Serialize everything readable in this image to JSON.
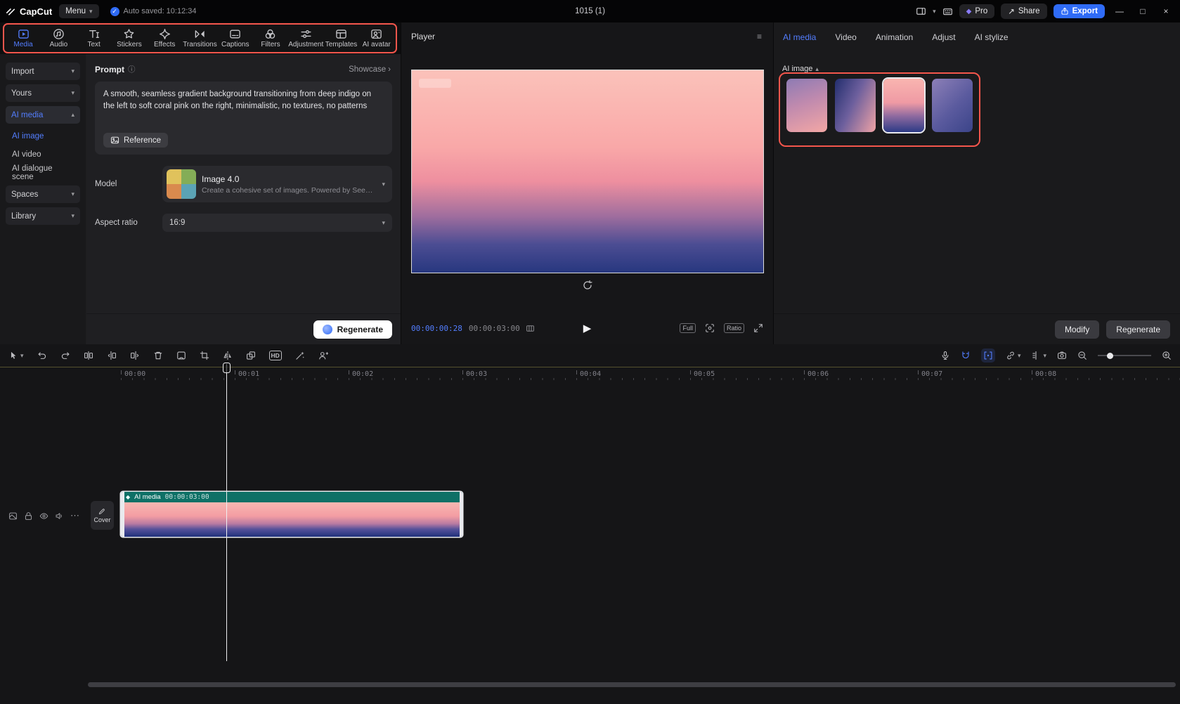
{
  "icons": {
    "chevron_down": "▾",
    "chevron_up": "▴",
    "chevron_right": "›",
    "play": "▶",
    "ellipsis": "⋯",
    "hamburger": "≡",
    "close": "×",
    "minimize": "—",
    "maximize": "□",
    "share_arrow": "↗",
    "gem": "◆",
    "check": "✓",
    "info": "ⓘ",
    "clip_sparkle": "◆"
  },
  "topbar": {
    "logo_text": "CapCut",
    "menu_label": "Menu",
    "autosave_text": "Auto saved: 10:12:34",
    "project_title": "1015 (1)",
    "pro_label": "Pro",
    "share_label": "Share",
    "export_label": "Export"
  },
  "toolbar": {
    "items": [
      {
        "label": "Media",
        "active": true
      },
      {
        "label": "Audio"
      },
      {
        "label": "Text"
      },
      {
        "label": "Stickers"
      },
      {
        "label": "Effects"
      },
      {
        "label": "Transitions"
      },
      {
        "label": "Captions"
      },
      {
        "label": "Filters"
      },
      {
        "label": "Adjustment"
      },
      {
        "label": "Templates"
      },
      {
        "label": "AI avatar"
      }
    ]
  },
  "sidebar": {
    "import_label": "Import",
    "yours_label": "Yours",
    "ai_media_label": "AI media",
    "ai_image_label": "AI image",
    "ai_video_label": "AI video",
    "ai_dialogue_label": "AI dialogue scene",
    "spaces_label": "Spaces",
    "library_label": "Library"
  },
  "prompt_panel": {
    "title": "Prompt",
    "showcase_label": "Showcase",
    "prompt_text": "A smooth, seamless gradient background transitioning from deep indigo on the left to soft coral pink on the right, minimalistic, no textures, no patterns",
    "reference_label": "Reference",
    "model_label": "Model",
    "model_name": "Image 4.0",
    "model_desc": "Create a cohesive set of images. Powered by Seedr...",
    "aspect_label": "Aspect ratio",
    "aspect_value": "16:9",
    "regenerate_label": "Regenerate"
  },
  "player": {
    "title": "Player",
    "current_time": "00:00:00:28",
    "duration": "00:00:03:00",
    "full_label": "Full",
    "ratio_label": "Ratio",
    "preview_gradient": {
      "angle": "180deg",
      "stops": [
        "#fbc2ba 0%",
        "#f9a8a8 38%",
        "#ee8f9f 55%",
        "#a06e9e 72%",
        "#4c4d93 86%",
        "#27377f 100%"
      ]
    }
  },
  "right_panel": {
    "tabs": [
      {
        "label": "AI media",
        "active": true
      },
      {
        "label": "Video"
      },
      {
        "label": "Animation"
      },
      {
        "label": "Adjust"
      },
      {
        "label": "AI stylize"
      }
    ],
    "section_label": "AI image",
    "thumbnails": [
      {
        "angle": "160deg",
        "stops": [
          "#8d7bb4 0%",
          "#c08aae 45%",
          "#f3a7a5 100%"
        ]
      },
      {
        "angle": "115deg",
        "stops": [
          "#222e6e 0%",
          "#6d5f9d 45%",
          "#f0a3a6 100%"
        ]
      },
      {
        "angle": "180deg",
        "stops": [
          "#f9b5b0 0%",
          "#ef9aa4 45%",
          "#8f6aa0 70%",
          "#2c3b86 100%"
        ]
      },
      {
        "angle": "135deg",
        "stops": [
          "#8d80b8 0%",
          "#5a5a9e 55%",
          "#3b4489 100%"
        ]
      }
    ],
    "modify_label": "Modify",
    "regenerate_label": "Regenerate"
  },
  "timeline": {
    "ruler_labels": [
      "00:00",
      "00:01",
      "00:02",
      "00:03",
      "00:04",
      "00:05",
      "00:06",
      "00:07",
      "00:08"
    ],
    "hd_label": "HD",
    "cover_label": "Cover",
    "clip": {
      "label": "AI media",
      "duration": "00:00:03:00",
      "gradient": {
        "angle": "180deg",
        "stops": [
          "#f8b7b1 0%",
          "#f39da3 40%",
          "#b97ba2 62%",
          "#55519a 78%",
          "#20307b 100%"
        ]
      }
    }
  },
  "colors": {
    "accent_blue": "#537eff",
    "highlight_red": "#f4564c",
    "export_blue": "#2f6bf6",
    "clip_teal": "#0e7066"
  }
}
